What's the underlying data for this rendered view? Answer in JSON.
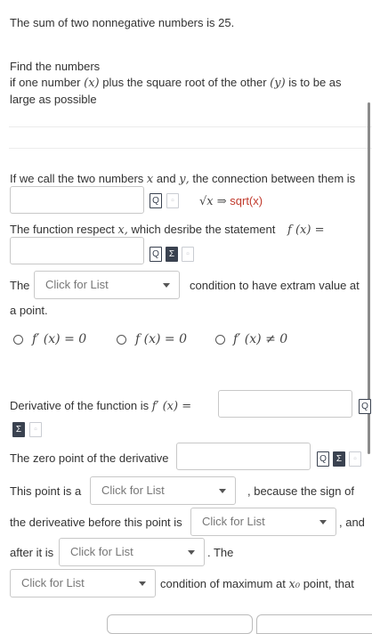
{
  "problem": {
    "intro": "The sum of two nonnegative numbers is 25.",
    "task_line1": "Find the numbers",
    "task_line2_a": "if one number",
    "var_x_paren": "(𝑥)",
    "task_line2_b": "plus the square root of the other",
    "var_y_paren": "(𝑦)",
    "task_line2_c": "is to be as",
    "task_line3": "large as possible"
  },
  "step1": {
    "text_a": "If we call the two numbers",
    "x": "𝑥",
    "text_and": "and",
    "y": "𝑦,",
    "text_b": "the connection between them is",
    "hint_math": "√𝑥 ⇒",
    "hint_text": "sqrt(x)"
  },
  "step2": {
    "text": "The function respect",
    "x": "𝑥,",
    "text_b": "which desribe the statement",
    "fx": "𝑓 (𝑥) ="
  },
  "step3": {
    "text_the": "The",
    "select_placeholder": "Click for List",
    "text_after": "condition to have extram value at",
    "text_line2": "a point."
  },
  "options": [
    {
      "label": "𝑓′ (𝑥) = 0"
    },
    {
      "label": "𝑓 (𝑥) = 0"
    },
    {
      "label": "𝑓′ (𝑥) ≠ 0"
    }
  ],
  "step4": {
    "text": "Derivative of the function is",
    "fx": "𝑓′ (𝑥) ="
  },
  "step5": {
    "text": "The zero point of the derivative"
  },
  "step6": {
    "text_a": "This point is a",
    "select1": "Click for List",
    "text_b": ", because the sign of",
    "text_c": "the deriveative before this point is",
    "select2": "Click for List",
    "text_d": ", and",
    "text_e": "after it is",
    "select3": "Click for List",
    "text_f": ". The",
    "select4": "Click for List",
    "text_g": "condition of maximum at",
    "x0": "𝑥₀",
    "text_h": "point, that"
  },
  "icons": {
    "preview": "preview-icon",
    "sigma": "sigma-icon",
    "page": "page-icon"
  }
}
